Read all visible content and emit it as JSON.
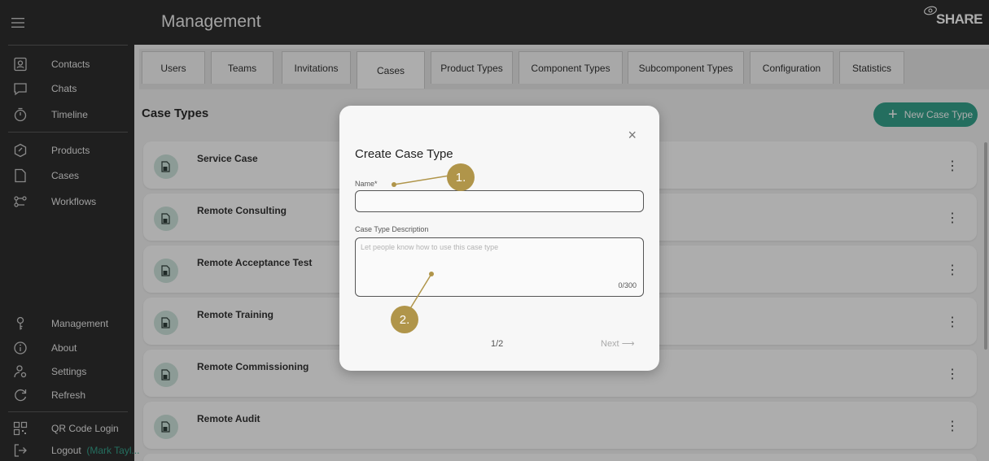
{
  "sidebar": {
    "items": [
      {
        "label": "Contacts",
        "icon": "contacts-icon"
      },
      {
        "label": "Chats",
        "icon": "chat-icon"
      },
      {
        "label": "Timeline",
        "icon": "timer-icon"
      },
      {
        "label": "Products",
        "icon": "product-icon"
      },
      {
        "label": "Cases",
        "icon": "cases-icon"
      },
      {
        "label": "Workflows",
        "icon": "workflow-icon"
      },
      {
        "label": "Management",
        "icon": "key-icon"
      },
      {
        "label": "About",
        "icon": "info-icon"
      },
      {
        "label": "Settings",
        "icon": "settings-icon"
      },
      {
        "label": "Refresh",
        "icon": "refresh-icon"
      },
      {
        "label": "QR Code Login",
        "icon": "qr-code-icon"
      },
      {
        "label": "Logout",
        "icon": "logout-icon"
      }
    ],
    "logout_user": "(Mark Tayl..."
  },
  "header": {
    "title": "Management",
    "logo_text": "SHARE"
  },
  "tabs": [
    {
      "label": "Users"
    },
    {
      "label": "Teams"
    },
    {
      "label": "Invitations"
    },
    {
      "label": "Cases"
    },
    {
      "label": "Product Types"
    },
    {
      "label": "Component Types"
    },
    {
      "label": "Subcomponent Types"
    },
    {
      "label": "Configuration"
    },
    {
      "label": "Statistics"
    }
  ],
  "main": {
    "section_title": "Case Types",
    "new_button": "New Case Type",
    "rows": [
      {
        "name": "Service Case"
      },
      {
        "name": "Remote Consulting"
      },
      {
        "name": "Remote Acceptance Test"
      },
      {
        "name": "Remote Training"
      },
      {
        "name": "Remote Commissioning"
      },
      {
        "name": "Remote Audit"
      }
    ]
  },
  "modal": {
    "title": "Create Case Type",
    "close": "×",
    "name_label": "Name*",
    "name_value": "",
    "desc_label": "Case Type Description",
    "desc_placeholder": "Let people know how to use this case type",
    "char_count": "0/300",
    "pager": "1/2",
    "next": "Next"
  },
  "annotations": [
    {
      "label": "1."
    },
    {
      "label": "2."
    }
  ],
  "colors": {
    "accent": "#36a38c",
    "sidebar_bg": "#2f2f2f",
    "annotation": "#b0954a"
  }
}
